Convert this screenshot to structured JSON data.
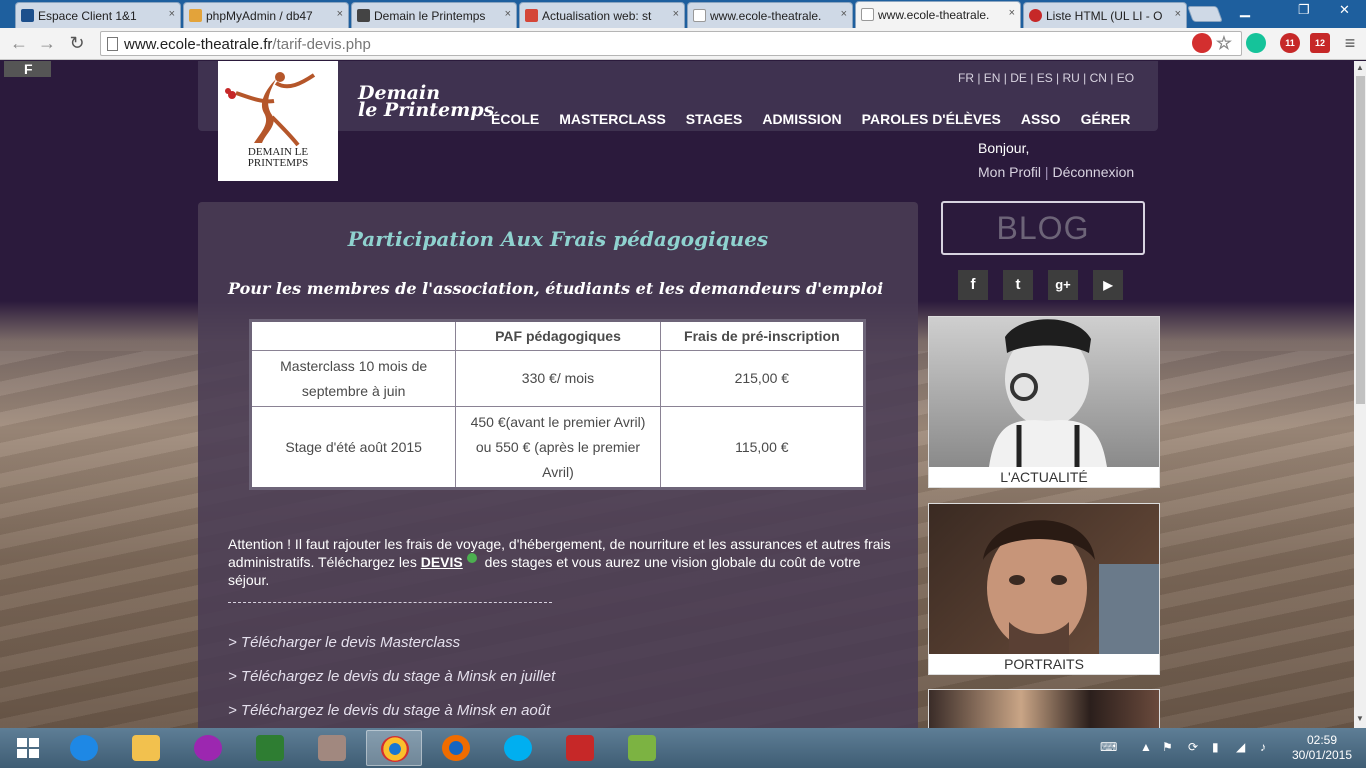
{
  "browser": {
    "tabs": [
      {
        "title": "Espace Client 1&1",
        "icon_color": "#1c4f8c"
      },
      {
        "title": "phpMyAdmin / db47",
        "icon_color": "#e3a33a"
      },
      {
        "title": "Demain le Printemps",
        "icon_color": "#444444"
      },
      {
        "title": "Actualisation web: st",
        "icon_color": "#d44638"
      },
      {
        "title": "www.ecole-theatrale.",
        "icon_color": "#ffffff"
      },
      {
        "title": "www.ecole-theatrale.",
        "icon_color": "#ffffff"
      },
      {
        "title": "Liste HTML (UL LI - O",
        "icon_color": "#c62828"
      }
    ],
    "active_tab_index": 5,
    "close_glyph": "×",
    "window_controls": {
      "minimize": "▁",
      "maximize": "❐",
      "close": "✕"
    },
    "url_host": "www.ecole-theatrale.fr",
    "url_path": "/tarif-devis.php",
    "extensions": [
      {
        "name": "lastpass-icon",
        "label": "",
        "color": "#d32f2f"
      },
      {
        "name": "bookmark-star-icon",
        "label": "☆",
        "color": "#888888"
      },
      {
        "name": "grammarly-icon",
        "label": "",
        "color": "#15c39a"
      },
      {
        "name": "adblock-badge-icon",
        "label": "11",
        "color": "#c62828"
      },
      {
        "name": "abp-icon",
        "label": "12",
        "color": "#c62828"
      },
      {
        "name": "menu-icon",
        "label": "≡",
        "color": "#555555"
      }
    ]
  },
  "site": {
    "brand_line1": "Demain",
    "brand_line2": "le Printemps",
    "logo_text_line1": "DEMAIN LE",
    "logo_text_line2": "PRINTEMPS",
    "corner_logo": "F",
    "languages": "FR | EN | DE | ES | RU | CN | EO",
    "nav": [
      "ÉCOLE",
      "MASTERCLASS",
      "STAGES",
      "ADMISSION",
      "PAROLES D'ÉLÈVES",
      "ASSO",
      "GÉRER"
    ],
    "greeting": "Bonjour,",
    "profile_link": "Mon Profil",
    "separator": "|",
    "logout_link": "Déconnexion"
  },
  "content": {
    "title": "Participation Aux Frais pédagogiques",
    "subtitle": "Pour les membres de l'association, étudiants et les demandeurs d'emploi",
    "table": {
      "headers": [
        "",
        "PAF pédagogiques",
        "Frais de pré-inscription"
      ],
      "rows": [
        [
          "Masterclass 10 mois de septembre à juin",
          "330 €/ mois",
          "215,00 €"
        ],
        [
          "Stage d'été août 2015",
          "450 €(avant le premier Avril) ou 550 € (après le premier Avril)",
          "115,00 €"
        ]
      ]
    },
    "notice_before": "Attention ! Il faut rajouter les frais de voyage, d'hébergement, de nourriture et les assurances et autres frais administratifs. Téléchargez les ",
    "notice_link": "DEVIS",
    "notice_after": " des stages et vous aurez une vision globale du coût de votre séjour.",
    "download_links": [
      "> Télécharger le devis Masterclass",
      "> Téléchargez le devis du stage à Minsk en juillet",
      "> Téléchargez le devis du stage à Minsk en août"
    ]
  },
  "sidebar": {
    "blog_label": "BLOG",
    "social": [
      {
        "name": "facebook-icon",
        "glyph": "f"
      },
      {
        "name": "twitter-icon",
        "glyph": "t"
      },
      {
        "name": "google-plus-icon",
        "glyph": "g+"
      },
      {
        "name": "youtube-icon",
        "glyph": "▶"
      }
    ],
    "cards": [
      {
        "caption": "L'ACTUALITÉ"
      },
      {
        "caption": "PORTRAITS"
      },
      {
        "caption": ""
      }
    ]
  },
  "taskbar": {
    "apps": [
      {
        "name": "start-button",
        "color": "#ffffff"
      },
      {
        "name": "internet-explorer-icon",
        "color": "#1e88e5"
      },
      {
        "name": "file-explorer-icon",
        "color": "#f2c14e"
      },
      {
        "name": "picasa-icon",
        "color": "#9c27b0"
      },
      {
        "name": "excel-store-icon",
        "color": "#2e7d32"
      },
      {
        "name": "notepad-icon",
        "color": "#a1887f"
      },
      {
        "name": "chrome-icon",
        "color": "#fbc02d"
      },
      {
        "name": "firefox-icon",
        "color": "#ef6c00"
      },
      {
        "name": "skype-icon",
        "color": "#00aff0"
      },
      {
        "name": "filezilla-icon",
        "color": "#c62828"
      },
      {
        "name": "notepadplusplus-icon",
        "color": "#7cb342"
      }
    ],
    "active_app_index": 6,
    "time": "02:59",
    "date": "30/01/2015"
  }
}
